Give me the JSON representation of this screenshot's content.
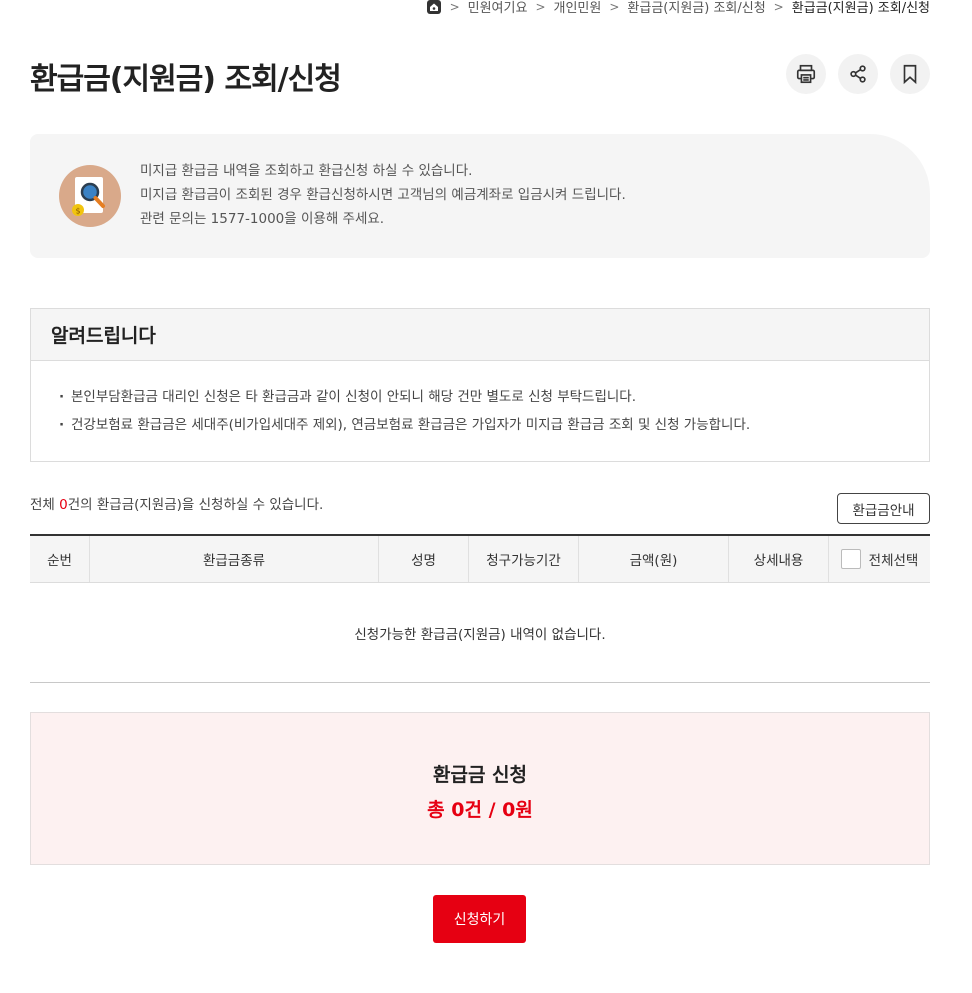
{
  "breadcrumb": {
    "items": [
      "민원여기요",
      "개인민원",
      "환급금(지원금) 조회/신청",
      "환급금(지원금) 조회/신청"
    ],
    "separator": ">"
  },
  "page": {
    "title": "환급금(지원금) 조회/신청"
  },
  "tools": {
    "icons": [
      "print-icon",
      "share-icon",
      "bookmark-icon"
    ]
  },
  "info": {
    "icon": "document-search-icon",
    "lines": [
      "미지급 환급금 내역을 조회하고 환급신청 하실 수 있습니다.",
      "미지급 환급금이 조회된 경우 환급신청하시면 고객님의 예금계좌로 입금시켜 드립니다.",
      "관련 문의는 1577-1000을 이용해 주세요."
    ]
  },
  "notice": {
    "title": "알려드립니다",
    "items": [
      "본인부담환급금 대리인 신청은 타 환급금과 같이 신청이 안되니 해당 건만 별도로 신청 부탁드립니다.",
      "건강보험료 환급금은 세대주(비가입세대주 제외), 연금보험료 환급금은 가입자가 미지급 환급금 조회 및 신청 가능합니다."
    ]
  },
  "count": {
    "prefix": "전체 ",
    "number": "0",
    "suffix": "건의 환급금(지원금)을 신청하실 수 있습니다."
  },
  "guide_button": "환급금안내",
  "table": {
    "headers": [
      "순번",
      "환급금종류",
      "성명",
      "청구가능기간",
      "금액(원)",
      "상세내용",
      "전체선택"
    ],
    "empty_message": "신청가능한 환급금(지원금) 내역이 없습니다."
  },
  "summary": {
    "title": "환급금 신청",
    "total": "총 0건 / 0원"
  },
  "submit_button": "신청하기",
  "colors": {
    "accent": "#e60012",
    "summary_bg": "#fdf1f1",
    "info_bg": "#f5f5f5"
  }
}
